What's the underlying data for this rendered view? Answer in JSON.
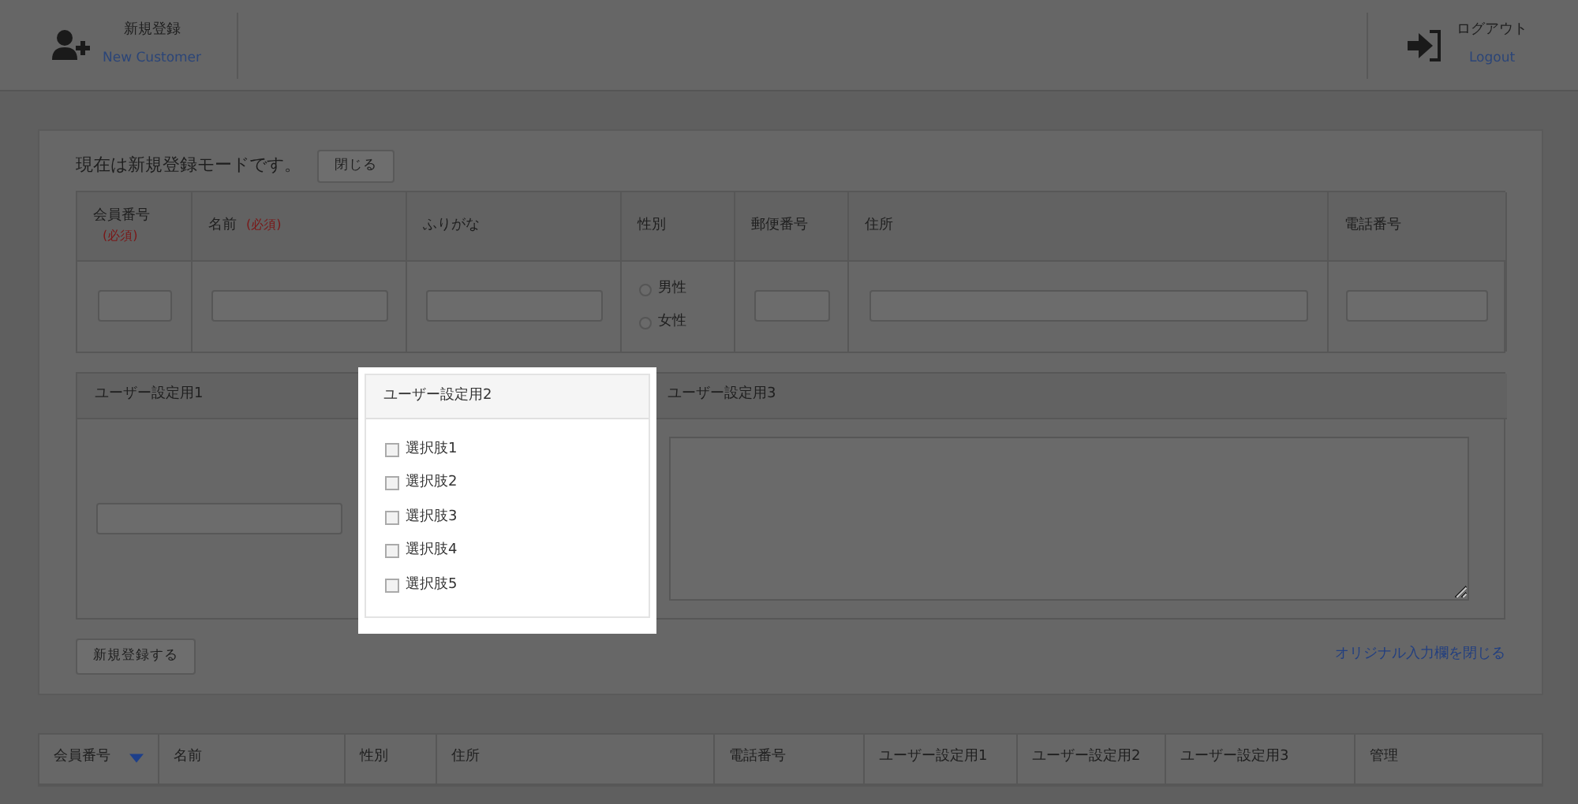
{
  "header": {
    "new_customer": {
      "label": "新規登録",
      "sublabel": "New Customer"
    },
    "logout": {
      "label": "ログアウト",
      "sublabel": "Logout"
    }
  },
  "form": {
    "mode_text": "現在は新規登録モードです。",
    "close_button": "閉じる",
    "fields": [
      {
        "label": "会員番号",
        "required_mark": "(必須)",
        "kind": "text"
      },
      {
        "label": "名前",
        "required_mark": "(必須)",
        "kind": "text"
      },
      {
        "label": "ふりがな",
        "kind": "text"
      },
      {
        "label": "性別",
        "kind": "radio",
        "options": [
          {
            "label": "男性",
            "selected": false
          },
          {
            "label": "女性",
            "selected": false
          }
        ]
      },
      {
        "label": "郵便番号",
        "kind": "text"
      },
      {
        "label": "住所",
        "kind": "text"
      },
      {
        "label": "電話番号",
        "kind": "text"
      }
    ],
    "custom_fields": [
      {
        "label": "ユーザー設定用1",
        "kind": "text",
        "highlighted": false
      },
      {
        "label": "ユーザー設定用2",
        "kind": "checkboxes",
        "highlighted": true,
        "options": [
          {
            "label": "選択肢1",
            "checked": false
          },
          {
            "label": "選択肢2",
            "checked": false
          },
          {
            "label": "選択肢3",
            "checked": false
          },
          {
            "label": "選択肢4",
            "checked": false
          },
          {
            "label": "選択肢5",
            "checked": false
          }
        ]
      },
      {
        "label": "ユーザー設定用3",
        "kind": "textarea",
        "highlighted": false
      }
    ],
    "submit_button": "新規登録する",
    "close_custom_link": "オリジナル入力欄を閉じる"
  },
  "list_table": {
    "columns": [
      {
        "label": "会員番号",
        "sorted": true
      },
      {
        "label": "名前",
        "sorted": false
      },
      {
        "label": "性別",
        "sorted": false
      },
      {
        "label": "住所",
        "sorted": false
      },
      {
        "label": "電話番号",
        "sorted": false
      },
      {
        "label": "ユーザー設定用1",
        "sorted": false
      },
      {
        "label": "ユーザー設定用2",
        "sorted": false
      },
      {
        "label": "ユーザー設定用3",
        "sorted": false
      },
      {
        "label": "管理",
        "sorted": false
      }
    ]
  }
}
